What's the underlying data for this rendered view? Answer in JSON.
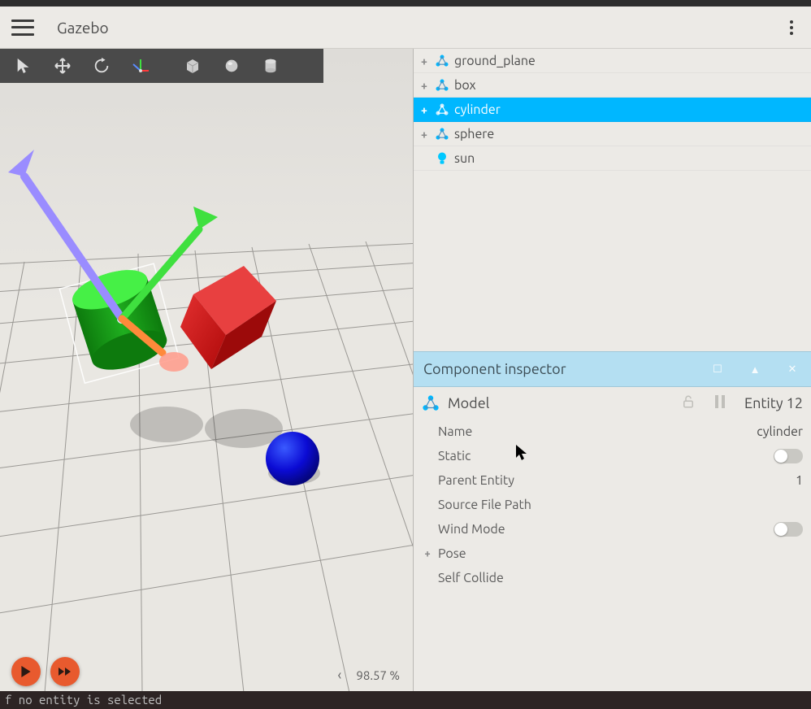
{
  "header": {
    "title": "Gazebo"
  },
  "toolbar": {
    "tools": [
      {
        "name": "select-tool",
        "icon": "cursor"
      },
      {
        "name": "move-tool",
        "icon": "move"
      },
      {
        "name": "rotate-tool",
        "icon": "rotate"
      },
      {
        "name": "transform-tool",
        "icon": "axes"
      },
      {
        "name": "box-shape",
        "icon": "box"
      },
      {
        "name": "sphere-shape",
        "icon": "sphere"
      },
      {
        "name": "cylinder-shape",
        "icon": "cylinder"
      }
    ]
  },
  "entity_tree": [
    {
      "label": "ground_plane",
      "icon": "model",
      "expandable": true,
      "selected": false
    },
    {
      "label": "box",
      "icon": "model",
      "expandable": true,
      "selected": false
    },
    {
      "label": "cylinder",
      "icon": "model",
      "expandable": true,
      "selected": true
    },
    {
      "label": "sphere",
      "icon": "model",
      "expandable": true,
      "selected": false
    },
    {
      "label": "sun",
      "icon": "light",
      "expandable": false,
      "selected": false
    }
  ],
  "inspector": {
    "title": "Component inspector",
    "type_label": "Model",
    "entity_label": "Entity 12",
    "properties": {
      "name": {
        "label": "Name",
        "value": "cylinder",
        "type": "text"
      },
      "static": {
        "label": "Static",
        "value": false,
        "type": "toggle"
      },
      "parent": {
        "label": "Parent Entity",
        "value": "1",
        "type": "text"
      },
      "source": {
        "label": "Source File Path",
        "value": "",
        "type": "text"
      },
      "wind": {
        "label": "Wind Mode",
        "value": false,
        "type": "toggle"
      },
      "pose": {
        "label": "Pose",
        "expandable": true
      },
      "self_collide": {
        "label": "Self Collide",
        "value": "",
        "type": "text"
      }
    }
  },
  "footer": {
    "rtf": "98.57 %"
  },
  "terminal": "f no entity is selected",
  "scene": {
    "objects": [
      {
        "name": "cylinder",
        "color_main": "#1fae1f",
        "color_side": "#3fe03f",
        "selected": true
      },
      {
        "name": "box",
        "color_main": "#c70f0f",
        "color_side": "#e33030"
      },
      {
        "name": "sphere",
        "color": "#0b0bd4"
      }
    ],
    "gizmo_colors": {
      "x": "#ff5a3a",
      "y": "#3fe03f",
      "z": "#8c8cff"
    }
  }
}
